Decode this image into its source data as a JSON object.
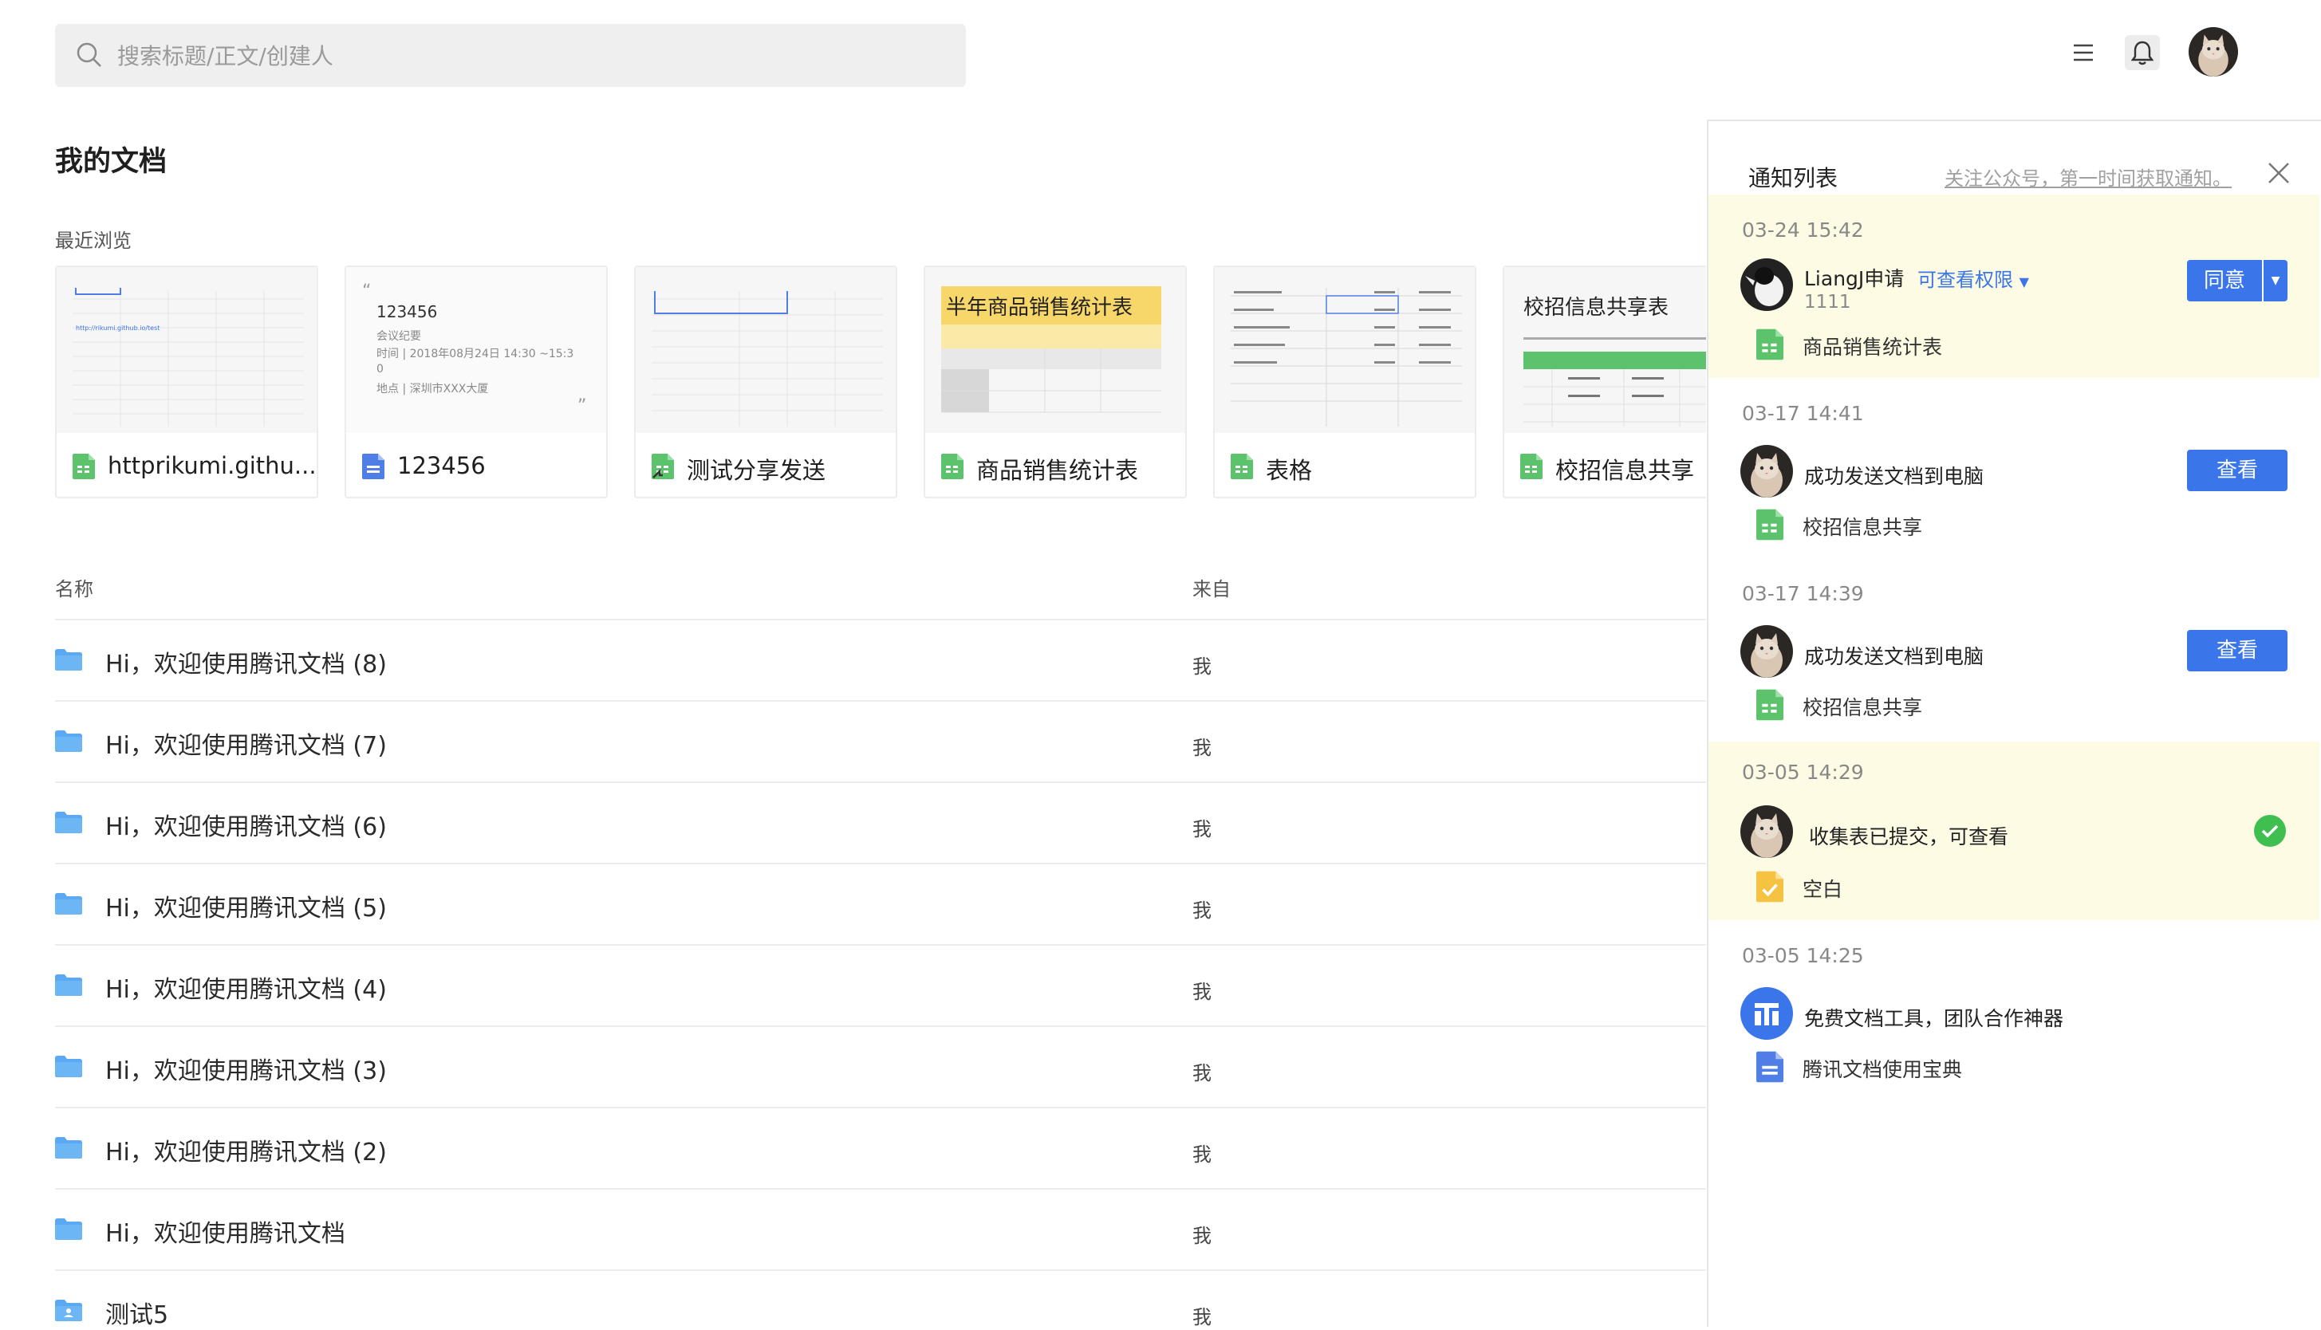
{
  "search": {
    "placeholder": "搜索标题/正文/创建人"
  },
  "page": {
    "title": "我的文档",
    "recent_label": "最近浏览"
  },
  "recent_cards": [
    {
      "title": "httprikumi.githu...",
      "type": "sheet",
      "thumb_text": "http://rikumi.github.io/test"
    },
    {
      "title": "123456",
      "type": "doc",
      "thumb_lines": [
        "123456",
        "会议纪要",
        "时间 | 2018年08月24日  14:30 ~15:3",
        "0",
        "地点 | 深圳市XXX大厦"
      ]
    },
    {
      "title": "测试分享发送",
      "type": "sheet-shared",
      "thumb_text": ""
    },
    {
      "title": "商品销售统计表",
      "type": "sheet",
      "thumb_text": "半年商品销售统计表"
    },
    {
      "title": "表格",
      "type": "sheet",
      "thumb_text": ""
    },
    {
      "title": "校招信息共享",
      "type": "sheet",
      "thumb_text": "校招信息共享表"
    }
  ],
  "table": {
    "col_name": "名称",
    "col_from": "来自",
    "rows": [
      {
        "name": "Hi，欢迎使用腾讯文档 (8)",
        "from": "我",
        "type": "folder"
      },
      {
        "name": "Hi，欢迎使用腾讯文档 (7)",
        "from": "我",
        "type": "folder"
      },
      {
        "name": "Hi，欢迎使用腾讯文档 (6)",
        "from": "我",
        "type": "folder"
      },
      {
        "name": "Hi，欢迎使用腾讯文档 (5)",
        "from": "我",
        "type": "folder"
      },
      {
        "name": "Hi，欢迎使用腾讯文档 (4)",
        "from": "我",
        "type": "folder"
      },
      {
        "name": "Hi，欢迎使用腾讯文档 (3)",
        "from": "我",
        "type": "folder"
      },
      {
        "name": "Hi，欢迎使用腾讯文档 (2)",
        "from": "我",
        "type": "folder"
      },
      {
        "name": "Hi，欢迎使用腾讯文档",
        "from": "我",
        "type": "folder"
      },
      {
        "name": "测试5",
        "from": "我",
        "type": "shared-folder"
      }
    ]
  },
  "notifications": {
    "title": "通知列表",
    "hint": "关注公众号，第一时间获取通知。",
    "items": [
      {
        "time": "03-24 15:42",
        "message": "LiangJ申请",
        "permission": "可查看权限",
        "sub": "1111",
        "doc": "商品销售统计表",
        "doc_type": "sheet",
        "action": "同意",
        "highlight": true
      },
      {
        "time": "03-17 14:41",
        "message": "成功发送文档到电脑",
        "doc": "校招信息共享",
        "doc_type": "sheet",
        "action": "查看",
        "highlight": false
      },
      {
        "time": "03-17 14:39",
        "message": "成功发送文档到电脑",
        "doc": "校招信息共享",
        "doc_type": "sheet",
        "action": "查看",
        "highlight": false
      },
      {
        "time": "03-05 14:29",
        "message": "收集表已提交，可查看",
        "doc": "空白",
        "doc_type": "form",
        "highlight": true
      },
      {
        "time": "03-05 14:25",
        "message": "免费文档工具，团队合作神器",
        "doc": "腾讯文档使用宝典",
        "doc_type": "doc",
        "highlight": false
      }
    ]
  },
  "colors": {
    "accent": "#3a76ea",
    "sheet_green": "#5cc26b",
    "doc_blue": "#4f7ee6",
    "folder_blue": "#5aa9f2",
    "highlight_bg": "#fdfbe3",
    "form_yellow": "#f5c242",
    "success_green": "#3fbf4f"
  }
}
